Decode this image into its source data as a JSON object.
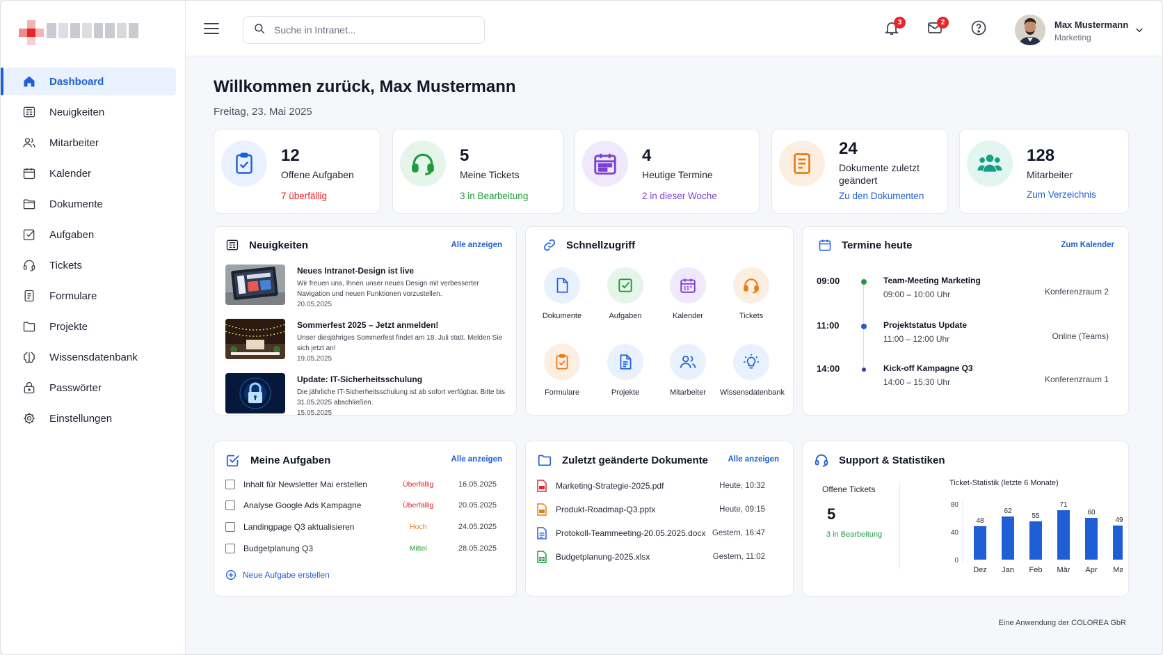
{
  "sidebar": {
    "items": [
      {
        "label": "Dashboard",
        "icon": "home-icon"
      },
      {
        "label": "Neuigkeiten",
        "icon": "newspaper-icon"
      },
      {
        "label": "Mitarbeiter",
        "icon": "users-icon"
      },
      {
        "label": "Kalender",
        "icon": "calendar-icon"
      },
      {
        "label": "Dokumente",
        "icon": "folder-icon"
      },
      {
        "label": "Aufgaben",
        "icon": "checkbox-icon"
      },
      {
        "label": "Tickets",
        "icon": "headset-icon"
      },
      {
        "label": "Formulare",
        "icon": "form-icon"
      },
      {
        "label": "Projekte",
        "icon": "folder-icon"
      },
      {
        "label": "Wissensdatenbank",
        "icon": "lightbulb-icon"
      },
      {
        "label": "Passwörter",
        "icon": "lock-icon"
      },
      {
        "label": "Einstellungen",
        "icon": "gear-icon"
      }
    ]
  },
  "header": {
    "search_placeholder": "Suche in Intranet...",
    "notifications_count": "3",
    "messages_count": "2",
    "user_name": "Max Mustermann",
    "user_role": "Marketing"
  },
  "welcome": {
    "title": "Willkommen zurück, Max Mustermann",
    "date": "Freitag, 23. Mai 2025"
  },
  "stats": [
    {
      "value": "12",
      "label": "Offene Aufgaben",
      "sub": "7 überfällig",
      "color": "#e5262b"
    },
    {
      "value": "5",
      "label": "Meine Tickets",
      "sub": "3 in Bearbeitung",
      "color": "#1f9a3c"
    },
    {
      "value": "4",
      "label": "Heutige Termine",
      "sub": "2 in dieser Woche",
      "color": "#7b3fd6"
    },
    {
      "value": "24",
      "label": "Dokumente zuletzt geändert",
      "sub": "Zu den Dokumenten",
      "color": "#1f5fd6"
    },
    {
      "value": "128",
      "label": "Mitarbeiter",
      "sub": "Zum Verzeichnis",
      "color": "#1f5fd6"
    }
  ],
  "news": {
    "title": "Neuigkeiten",
    "link": "Alle anzeigen",
    "items": [
      {
        "title": "Neues Intranet-Design ist live",
        "text": "Wir freuen uns, Ihnen unser neues Design mit verbesserter Navigation und neuen Funktionen vorzustellen.",
        "date": "20.05.2025"
      },
      {
        "title": "Sommerfest 2025 – Jetzt anmelden!",
        "text": "Unser diesjähriges Sommerfest findet am 18. Juli statt. Melden Sie sich jetzt an!",
        "date": "19.05.2025"
      },
      {
        "title": "Update: IT-Sicherheitsschulung",
        "text": "Die jährliche IT-Sicherheitsschulung ist ab sofort verfügbar. Bitte bis 31.05.2025 abschließen.",
        "date": "15.05.2025"
      }
    ]
  },
  "quick": {
    "title": "Schnellzugriff",
    "items": [
      {
        "label": "Dokumente",
        "icon": "document-icon"
      },
      {
        "label": "Aufgaben",
        "icon": "checkbox-icon"
      },
      {
        "label": "Kalender",
        "icon": "calendar-icon"
      },
      {
        "label": "Tickets",
        "icon": "headset-icon"
      },
      {
        "label": "Formulare",
        "icon": "clipboard-icon"
      },
      {
        "label": "Projekte",
        "icon": "file-text-icon"
      },
      {
        "label": "Mitarbeiter",
        "icon": "users-icon"
      },
      {
        "label": "Wissensdatenbank",
        "icon": "lightbulb-icon"
      }
    ]
  },
  "appointments": {
    "title": "Termine heute",
    "link": "Zum Kalender",
    "items": [
      {
        "time": "09:00",
        "title": "Team-Meeting Marketing",
        "span": "09:00 – 10:00 Uhr",
        "room": "Konferenzraum 2",
        "color": "#1f9a3c"
      },
      {
        "time": "11:00",
        "title": "Projektstatus Update",
        "span": "11:00 – 12:00 Uhr",
        "room": "Online (Teams)",
        "color": "#1f5fd6"
      },
      {
        "time": "14:00",
        "title": "Kick-off Kampagne Q3",
        "span": "14:00 – 15:30 Uhr",
        "room": "Konferenzraum 1",
        "color": "#5b2bb5"
      }
    ]
  },
  "tasks": {
    "title": "Meine Aufgaben",
    "link": "Alle anzeigen",
    "items": [
      {
        "title": "Inhalt für Newsletter Mai erstellen",
        "priority": "Überfällig",
        "color": "#e5262b",
        "date": "16.05.2025"
      },
      {
        "title": "Analyse Google Ads Kampagne",
        "priority": "Überfällig",
        "color": "#e5262b",
        "date": "20.05.2025"
      },
      {
        "title": "Landingpage Q3 aktualisieren",
        "priority": "Hoch",
        "color": "#ea7b10",
        "date": "24.05.2025"
      },
      {
        "title": "Budgetplanung Q3",
        "priority": "Mittel",
        "color": "#1f9a3c",
        "date": "28.05.2025"
      }
    ],
    "new_task": "Neue Aufgabe erstellen"
  },
  "documents": {
    "title": "Zuletzt geänderte Dokumente",
    "link": "Alle anzeigen",
    "items": [
      {
        "name": "Marketing-Strategie-2025.pdf",
        "time": "Heute, 10:32",
        "color": "#e5262b"
      },
      {
        "name": "Produkt-Roadmap-Q3.pptx",
        "time": "Heute, 09:15",
        "color": "#ea7b10"
      },
      {
        "name": "Protokoll-Teammeeting-20.05.2025.docx",
        "time": "Gestern, 16:47",
        "color": "#1f5fd6"
      },
      {
        "name": "Budgetplanung-2025.xlsx",
        "time": "Gestern, 11:02",
        "color": "#1f9a3c"
      }
    ]
  },
  "support": {
    "title": "Support & Statistiken",
    "open_label": "Offene Tickets",
    "open_value": "5",
    "open_sub": "3 in Bearbeitung"
  },
  "chart_data": {
    "type": "bar",
    "title": "Ticket-Statistik (letzte 6 Monate)",
    "categories": [
      "Dez",
      "Jan",
      "Feb",
      "Mär",
      "Apr",
      "Mai"
    ],
    "values": [
      48,
      62,
      55,
      71,
      60,
      49
    ],
    "yticks": [
      0,
      40,
      80
    ],
    "ylim": [
      0,
      80
    ],
    "color": "#1f5fd6"
  },
  "footer": "Eine Anwendung der COLOREA GbR"
}
